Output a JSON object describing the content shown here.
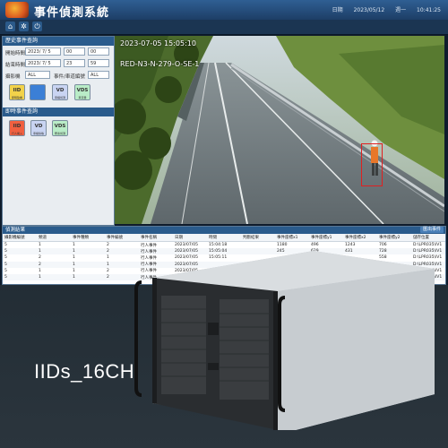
{
  "app": {
    "title": "事件偵測系統",
    "header_right": [
      "日期",
      "2023/05/12",
      "週一",
      "10:41:25"
    ]
  },
  "toolbar": {
    "items": [
      {
        "name": "home",
        "icon": "home-icon",
        "glyph": "⌂"
      },
      {
        "name": "settings",
        "icon": "gear-icon",
        "glyph": "✲"
      },
      {
        "name": "power",
        "icon": "power-icon",
        "glyph": "⏻"
      }
    ]
  },
  "left_panel": {
    "query_section_title": "歷史事件查詢",
    "start_label": "開始時間",
    "start_date": "2023/ 7/ 5",
    "start_hour": "00",
    "start_min": "00",
    "end_label": "結束時間",
    "end_date": "2023/ 7/ 5",
    "end_hour": "23",
    "end_min": "59",
    "camera_label": "攝影機",
    "camera_value": "ALL",
    "event_type_label": "事件/車道編號",
    "event_type_value": "ALL",
    "query_buttons": [
      {
        "label": "IID",
        "sub": "即時監看",
        "color": "#f2d24a"
      },
      {
        "label": "",
        "sub": "",
        "color": "#3b7fd6"
      },
      {
        "label": "VD",
        "sub": "車輛偵測",
        "color": "#c9d4f2"
      },
      {
        "label": "VDS",
        "sub": "車流量",
        "color": "#b9ecc7"
      }
    ],
    "event_section_title": "即時事件查詢",
    "event_buttons": [
      {
        "label": "IID",
        "sub": "行人闖入",
        "color": "#f06040"
      },
      {
        "label": "VD",
        "sub": "車輛停等",
        "color": "#c9d4f2"
      },
      {
        "label": "VDS",
        "sub": "壅塞偵測",
        "color": "#b9ecc7"
      }
    ]
  },
  "video": {
    "timestamp": "2023-07-05 15:05:10",
    "camera_id": "RED-N3-N-279-O-SE-1"
  },
  "results": {
    "title": "偵測結果",
    "export_label": "匯出事件",
    "columns": [
      "攝影機編號",
      "頻道",
      "事件種類",
      "事件編號",
      "事件名稱",
      "日期",
      "時間",
      "判斷結果",
      "事件座標x1",
      "事件座標y1",
      "事件座標x2",
      "事件座標y2",
      "儲存位置"
    ],
    "rows": [
      [
        "5",
        "1",
        "1",
        "2",
        "行人事件",
        "2023/07/05",
        "15:04:18",
        "",
        "1180",
        "496",
        "1243",
        "706",
        "D:\\LPR035\\IV1"
      ],
      [
        "5",
        "1",
        "1",
        "2",
        "行人事件",
        "2023/07/05",
        "15:05:04",
        "",
        "245",
        "629",
        "431",
        "728",
        "D:\\LPR035\\IV1"
      ],
      [
        "5",
        "2",
        "1",
        "1",
        "行人事件",
        "2023/07/05",
        "15:05:11",
        "",
        "",
        "",
        "",
        "558",
        "D:\\LPR035\\IV1"
      ],
      [
        "5",
        "2",
        "1",
        "1",
        "行人事件",
        "2023/07/05",
        "",
        "",
        "",
        "",
        "",
        "",
        "D:\\LPR035\\IV1"
      ],
      [
        "5",
        "1",
        "1",
        "2",
        "行人事件",
        "2023/07/05",
        "",
        "",
        "",
        "",
        "",
        "",
        "D:\\LPR035\\IV1"
      ],
      [
        "5",
        "1",
        "1",
        "2",
        "行人事件",
        "2023/07/05",
        "",
        "",
        "",
        "",
        "",
        "",
        "D:\\LPR035\\IV1"
      ]
    ]
  },
  "product": {
    "model_name": "IIDs_16CH"
  }
}
